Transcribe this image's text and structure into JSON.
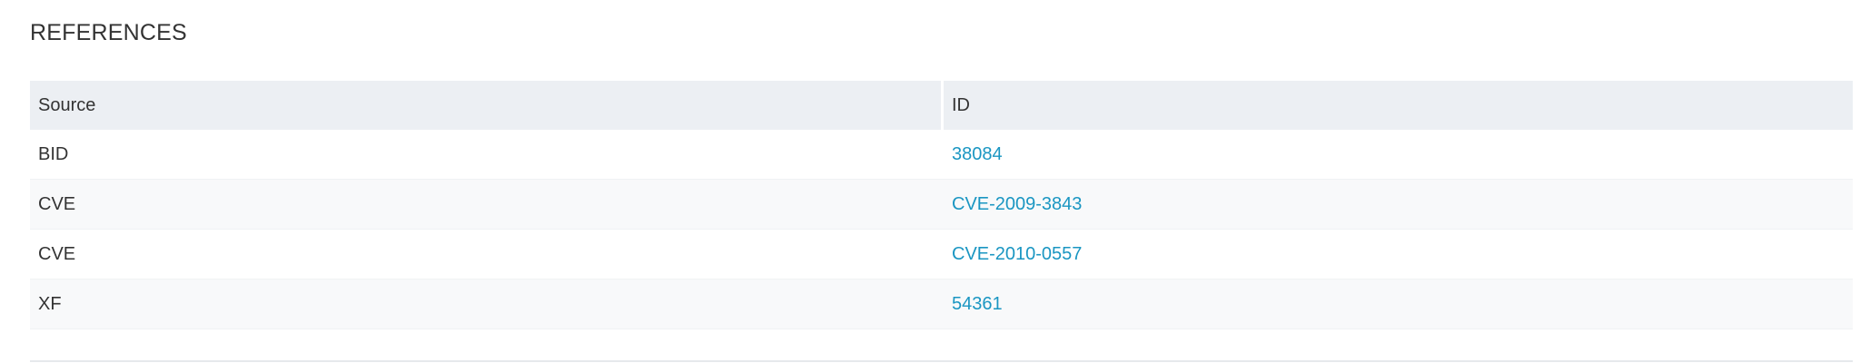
{
  "section": {
    "title": "REFERENCES"
  },
  "table": {
    "headers": {
      "source": "Source",
      "id": "ID"
    },
    "rows": [
      {
        "source": "BID",
        "id": "38084"
      },
      {
        "source": "CVE",
        "id": "CVE-2009-3843"
      },
      {
        "source": "CVE",
        "id": "CVE-2010-0557"
      },
      {
        "source": "XF",
        "id": "54361"
      }
    ]
  },
  "colors": {
    "link": "#1a96c2",
    "header_bg": "#eceff3",
    "stripe_bg": "#f8f9fa",
    "text": "#333333"
  }
}
